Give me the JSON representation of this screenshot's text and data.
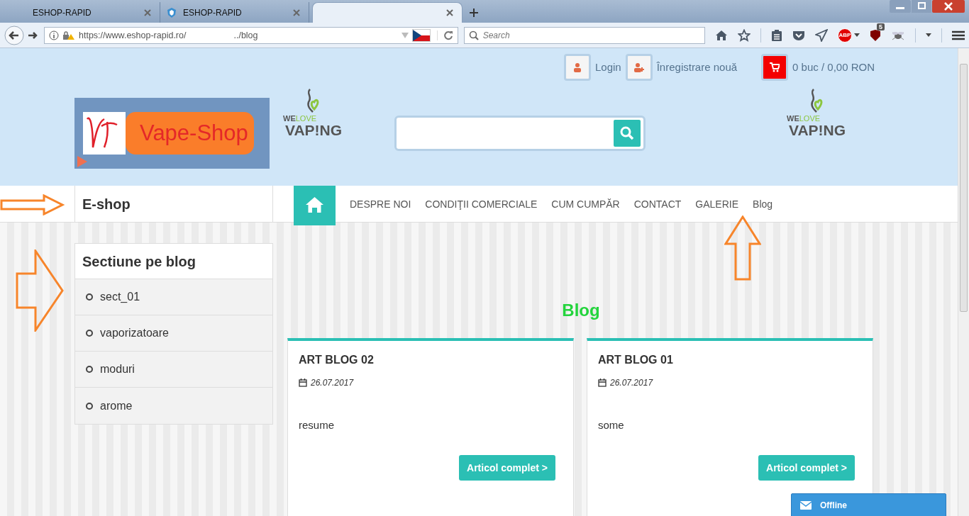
{
  "browser": {
    "tabs": [
      {
        "title": "ESHOP-RAPID",
        "selected": false,
        "icon": false
      },
      {
        "title": "ESHOP-RAPID",
        "selected": false,
        "icon": true
      },
      {
        "selected": true,
        "icon": false
      }
    ],
    "url": {
      "host": "https://www.eshop-rapid.ro/",
      "path": "../blog"
    },
    "search": {
      "placeholder": "Search"
    },
    "toolbar": [
      {
        "kind": "home"
      },
      {
        "kind": "star"
      },
      {
        "kind": "reader"
      },
      {
        "kind": "pocket"
      },
      {
        "kind": "send"
      },
      {
        "kind": "abp",
        "label": "ABP"
      },
      {
        "kind": "ublock",
        "badge": "5"
      },
      {
        "kind": "bug"
      },
      {
        "kind": "menu"
      }
    ]
  },
  "header": {
    "login": "Login",
    "register": "Înregistrare nouă",
    "cart": "0 buc / 0,00 RON",
    "logo": "Vape-Shop",
    "pattern": [
      {
        "top_a": "WE",
        "top_b": "LOVE",
        "bottom": "VAP!NG"
      },
      {
        "top_a": "WE",
        "top_b": "LOVE",
        "bottom": "VAP!NG"
      }
    ]
  },
  "nav": {
    "category": "E-shop",
    "links": [
      {
        "label": "DESPRE NOI"
      },
      {
        "label": "CONDIŢII COMERCIALE"
      },
      {
        "label": "CUM CUMPĂR"
      },
      {
        "label": "CONTACT"
      },
      {
        "label": "GALERIE"
      },
      {
        "label": "Blog"
      }
    ]
  },
  "sidebar": {
    "title": "Sectiune pe blog",
    "items": [
      "sect_01",
      "vaporizatoare",
      "moduri",
      "arome"
    ]
  },
  "main": {
    "title": "Blog",
    "posts": [
      {
        "title": "ART BLOG 02",
        "date": "26.07.2017",
        "summary": "resume",
        "button": "Articol complet >"
      },
      {
        "title": "ART BLOG 01",
        "date": "26.07.2017",
        "summary": "some",
        "button": "Articol complet >"
      }
    ]
  },
  "chat": {
    "label": "Offline"
  }
}
